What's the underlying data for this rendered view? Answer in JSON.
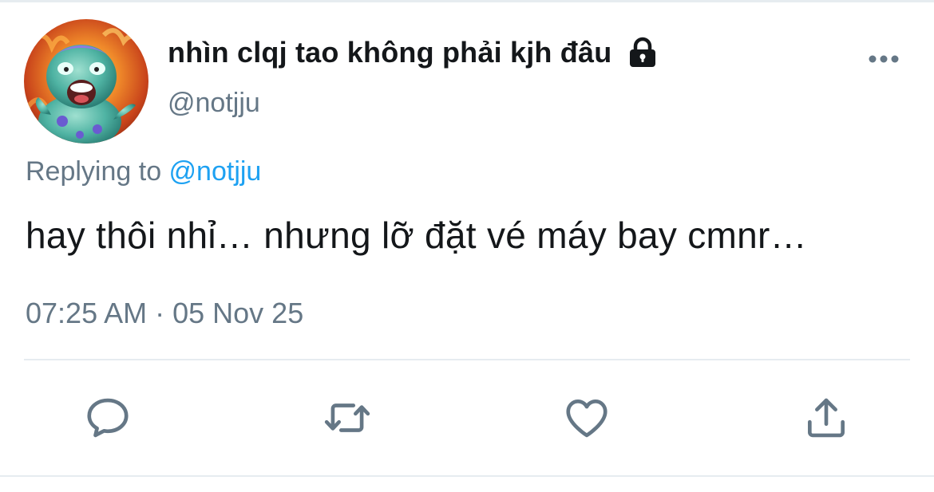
{
  "tweet": {
    "display_name": "nhìn clqj tao không phải kjh đâu",
    "handle": "@notjju",
    "replying_prefix": "Replying to ",
    "replying_to": "@notjju",
    "text": "hay thôi nhỉ… nhưng lỡ đặt vé máy bay cmnr…",
    "time": "07:25 AM",
    "separator": " · ",
    "date": "05 Nov 25"
  },
  "icons": {
    "lock": "lock-icon",
    "more": "more-dots-icon",
    "reply": "reply-bubble-icon",
    "retweet": "retweet-icon",
    "like": "heart-icon",
    "share": "share-icon"
  },
  "colors": {
    "text_primary": "#14171a",
    "text_secondary": "#657786",
    "accent": "#1da1f2",
    "icon": "#657786",
    "divider": "#e6ecf0"
  }
}
